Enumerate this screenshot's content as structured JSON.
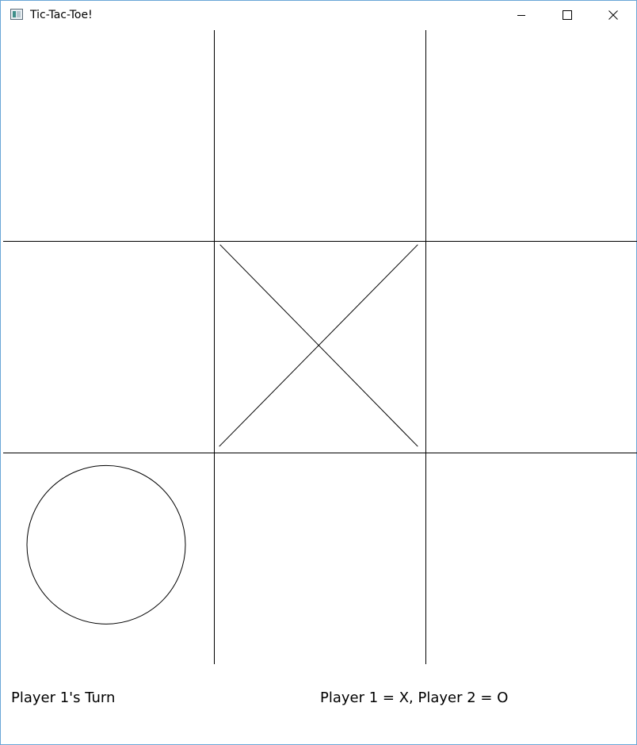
{
  "window": {
    "title": "Tic-Tac-Toe!",
    "icons": {
      "app": "app-window-icon",
      "minimize": "minimize-icon",
      "maximize": "maximize-icon",
      "close": "close-icon"
    }
  },
  "board": {
    "rows": 3,
    "cols": 3,
    "cells": [
      [
        "",
        "",
        ""
      ],
      [
        "",
        "X",
        ""
      ],
      [
        "O",
        "",
        ""
      ]
    ]
  },
  "status": {
    "turn_text": "Player 1's Turn",
    "legend_text": "Player 1 = X, Player 2 = O"
  }
}
